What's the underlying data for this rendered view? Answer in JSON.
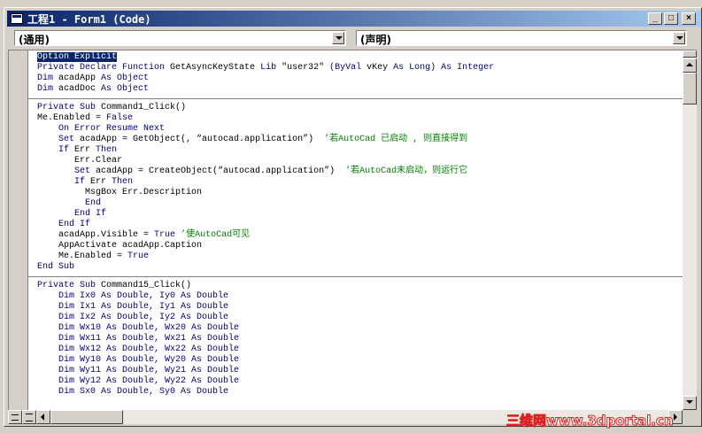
{
  "window": {
    "title": "工程1 - Form1 (Code)",
    "buttons": [
      "_",
      "□",
      "×"
    ]
  },
  "object_combo": {
    "value": "(通用)"
  },
  "proc_combo": {
    "value": "(声明)"
  },
  "code": {
    "sections": [
      {
        "lines": [
          [
            [
              "sel",
              "Option Explicit"
            ]
          ],
          [
            [
              "k",
              "Private Declare Function "
            ],
            [
              "t",
              "GetAsyncKeyState "
            ],
            [
              "k",
              "Lib "
            ],
            [
              "t",
              "\"user32\" "
            ],
            [
              "k",
              "(ByVal "
            ],
            [
              "t",
              "vKey "
            ],
            [
              "k",
              "As Long"
            ],
            [
              "t",
              ") "
            ],
            [
              "k",
              "As Integer"
            ]
          ],
          [
            [
              "k",
              "Dim "
            ],
            [
              "t",
              "acadApp "
            ],
            [
              "k",
              "As Object"
            ]
          ],
          [
            [
              "k",
              "Dim "
            ],
            [
              "t",
              "acadDoc "
            ],
            [
              "k",
              "As Object"
            ]
          ]
        ]
      },
      {
        "lines": [
          [
            [
              "k",
              "Private Sub "
            ],
            [
              "t",
              "Command1_Click()"
            ]
          ],
          [
            [
              "t",
              "Me.Enabled = "
            ],
            [
              "k",
              "False"
            ]
          ],
          [
            [
              "t",
              "    "
            ],
            [
              "k",
              "On Error Resume Next"
            ]
          ],
          [
            [
              "t",
              "    "
            ],
            [
              "k",
              "Set "
            ],
            [
              "t",
              "acadApp = GetObject(, “autocad.application”)  "
            ],
            [
              "c",
              "’若AutoCad 已启动 , 则直接得到"
            ]
          ],
          [
            [
              "t",
              "    "
            ],
            [
              "k",
              "If "
            ],
            [
              "t",
              "Err "
            ],
            [
              "k",
              "Then"
            ]
          ],
          [
            [
              "t",
              "       Err.Clear"
            ]
          ],
          [
            [
              "t",
              "       "
            ],
            [
              "k",
              "Set "
            ],
            [
              "t",
              "acadApp = CreateObject(“autocad.application”)  "
            ],
            [
              "c",
              "’若AutoCad未启动，则运行它"
            ]
          ],
          [
            [
              "t",
              "       "
            ],
            [
              "k",
              "If "
            ],
            [
              "t",
              "Err "
            ],
            [
              "k",
              "Then"
            ]
          ],
          [
            [
              "t",
              "         MsgBox Err.Description"
            ]
          ],
          [
            [
              "t",
              "         "
            ],
            [
              "k",
              "End"
            ]
          ],
          [
            [
              "t",
              "       "
            ],
            [
              "k",
              "End If"
            ]
          ],
          [
            [
              "t",
              "    "
            ],
            [
              "k",
              "End If"
            ]
          ],
          [
            [
              "t",
              "    acadApp.Visible = "
            ],
            [
              "k",
              "True"
            ],
            [
              "t",
              " "
            ],
            [
              "c",
              "’使AutoCad可见"
            ]
          ],
          [
            [
              "t",
              "    AppActivate acadApp.Caption"
            ]
          ],
          [
            [
              "t",
              "    Me.Enabled = "
            ],
            [
              "k",
              "True"
            ]
          ],
          [
            [
              "k",
              "End Sub"
            ]
          ]
        ]
      },
      {
        "lines": [
          [
            [
              "k",
              "Private Sub "
            ],
            [
              "t",
              "Command15_Click()"
            ]
          ],
          [
            [
              "k",
              "    Dim Ix0 As Double, Iy0 As Double"
            ]
          ],
          [
            [
              "k",
              "    Dim Ix1 As Double, Iy1 As Double"
            ]
          ],
          [
            [
              "k",
              "    Dim Ix2 As Double, Iy2 As Double"
            ]
          ],
          [
            [
              "k",
              "    Dim Wx10 As Double, Wx20 As Double"
            ]
          ],
          [
            [
              "k",
              "    Dim Wx11 As Double, Wx21 As Double"
            ]
          ],
          [
            [
              "k",
              "    Dim Wx12 As Double, Wx22 As Double"
            ]
          ],
          [
            [
              "k",
              "    Dim Wy10 As Double, Wy20 As Double"
            ]
          ],
          [
            [
              "k",
              "    Dim Wy11 As Double, Wy21 As Double"
            ]
          ],
          [
            [
              "k",
              "    Dim Wy12 As Double, Wy22 As Double"
            ]
          ],
          [
            [
              "k",
              "    Dim Sx0 As Double, Sy0 As Double"
            ]
          ]
        ]
      }
    ]
  },
  "colors": {
    "keyword": "#00008b",
    "comment": "#008000",
    "title_bar": "#0a246a",
    "selection": "#0a246a"
  },
  "watermark": "三维网www.3dportal.cn"
}
